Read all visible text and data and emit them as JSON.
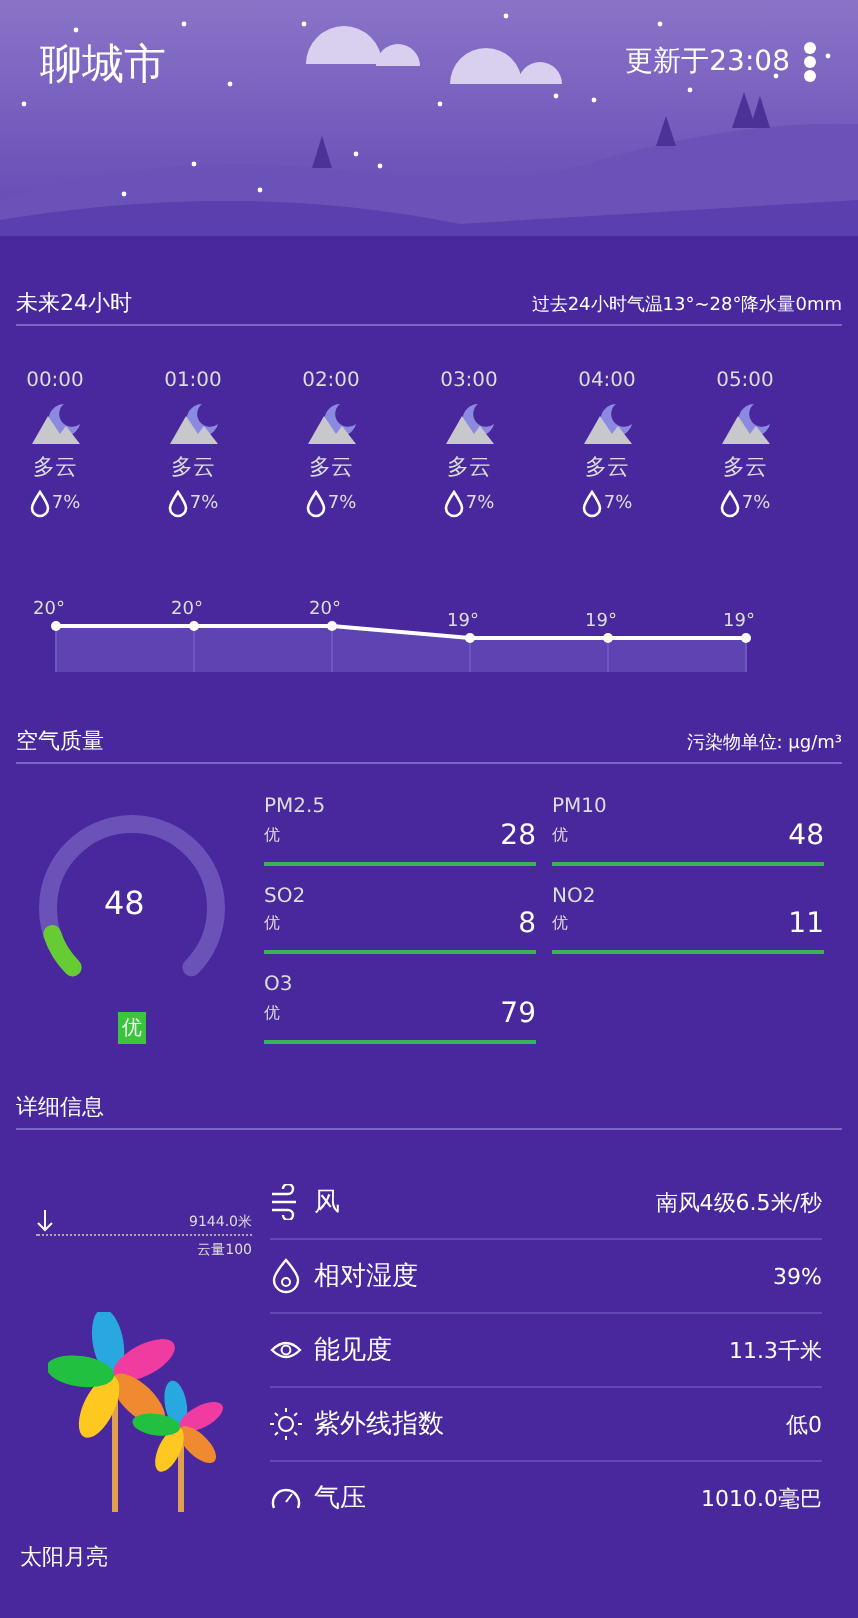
{
  "header": {
    "city": "聊城市",
    "updated": "更新于23:08"
  },
  "forecast": {
    "title": "未来24小时",
    "summary": "过去24小时气温13°~28°降水量0mm",
    "hours": [
      {
        "time": "00:00",
        "condition": "多云",
        "precip": "7%"
      },
      {
        "time": "01:00",
        "condition": "多云",
        "precip": "7%"
      },
      {
        "time": "02:00",
        "condition": "多云",
        "precip": "7%"
      },
      {
        "time": "03:00",
        "condition": "多云",
        "precip": "7%"
      },
      {
        "time": "04:00",
        "condition": "多云",
        "precip": "7%"
      },
      {
        "time": "05:00",
        "condition": "多云",
        "precip": "7%"
      }
    ],
    "chart_data": {
      "type": "line",
      "categories": [
        null,
        null,
        null,
        null,
        null,
        null
      ],
      "series": [
        {
          "color": "#ffffff",
          "marker": "circle",
          "values": [
            20,
            20,
            20,
            19,
            19,
            19
          ]
        }
      ],
      "data_labels": true
    },
    "temperature_unit": "°"
  },
  "air": {
    "title": "空气质量",
    "unit": "污染物单位: μg/m³",
    "aqi": "48",
    "grade": "优",
    "pollutants": [
      {
        "name": "PM2.5",
        "grade": "优",
        "value": "28"
      },
      {
        "name": "PM10",
        "grade": "优",
        "value": "48"
      },
      {
        "name": "SO2",
        "grade": "优",
        "value": "8"
      },
      {
        "name": "NO2",
        "grade": "优",
        "value": "11"
      },
      {
        "name": "O3",
        "grade": "优",
        "value": "79"
      }
    ]
  },
  "details": {
    "title": "详细信息",
    "cloud_height": "9144.0米",
    "cloud_cover": "云量100",
    "rows": [
      {
        "kind": "wind",
        "label": "风",
        "value": "南风4级6.5米/秒"
      },
      {
        "kind": "humidity",
        "label": "相对湿度",
        "value": "39%"
      },
      {
        "kind": "visibility",
        "label": "能见度",
        "value": "11.3千米"
      },
      {
        "kind": "uv",
        "label": "紫外线指数",
        "value": "低0"
      },
      {
        "kind": "pressure",
        "label": "气压",
        "value": "1010.0毫巴"
      }
    ]
  },
  "next_section": {
    "title": "太阳月亮"
  }
}
